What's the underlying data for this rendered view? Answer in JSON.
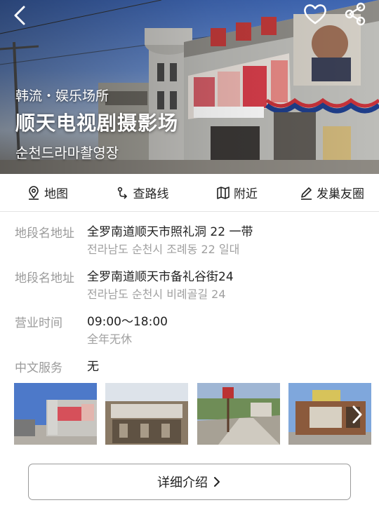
{
  "header": {
    "category": "韩流・娱乐场所",
    "title": "顺天电视剧摄影场",
    "subtitle": "순천드라마촬영장"
  },
  "icons": {
    "back": "chevron-left-icon",
    "favorite": "heart-icon",
    "share": "share-icon",
    "map": "map-pin-icon",
    "route": "route-icon",
    "nearby": "folded-map-icon",
    "post": "pencil-icon",
    "next": "chevron-right-icon"
  },
  "actions": [
    {
      "label": "地图"
    },
    {
      "label": "查路线"
    },
    {
      "label": "附近"
    },
    {
      "label": "发巢友圈"
    }
  ],
  "info": [
    {
      "label": "地段名地址",
      "primary": "全罗南道顺天市照礼洞 22 一带",
      "secondary": "전라남도 순천시 조례동 22 일대"
    },
    {
      "label": "地段名地址",
      "primary": "全罗南道顺天市备礼谷街24",
      "secondary": "전라남도 순천시 비례골길 24"
    },
    {
      "label": "营业时间",
      "primary": "09:00～18:00",
      "secondary": "全年无休"
    },
    {
      "label": "中文服务",
      "primary": "无"
    }
  ],
  "detail_button": {
    "label": "详细介绍"
  },
  "colors": {
    "text": "#222222",
    "muted": "#9a9a9a",
    "divider": "#e4e4e4",
    "sky": "#4f75c2"
  }
}
